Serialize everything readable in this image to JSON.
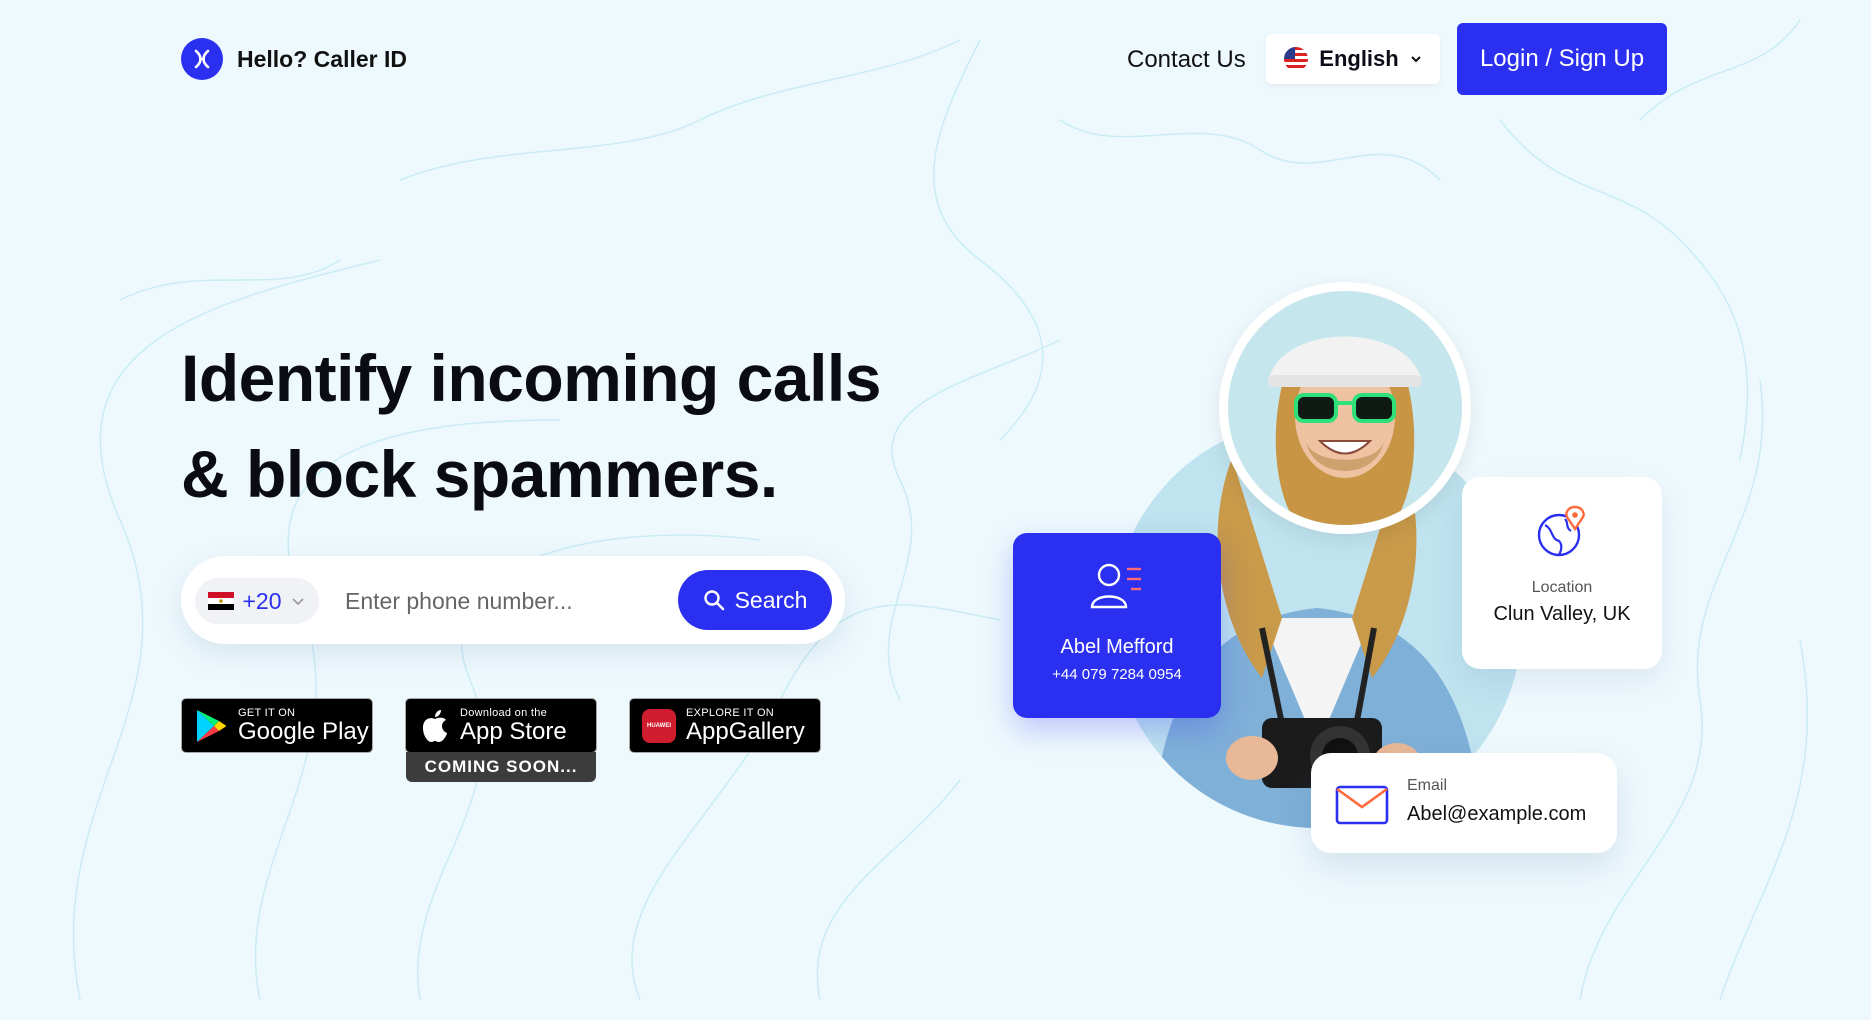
{
  "header": {
    "brand": "Hello? Caller ID",
    "contact_label": "Contact Us",
    "language": "English",
    "login_label": "Login / Sign Up"
  },
  "hero": {
    "headline_line1": "Identify incoming calls",
    "headline_line2": "& block spammers."
  },
  "search": {
    "country_code": "+20",
    "placeholder": "Enter phone number...",
    "button_label": "Search"
  },
  "stores": {
    "google": {
      "small": "GET IT ON",
      "big": "Google Play"
    },
    "apple": {
      "small": "Download on the",
      "big": "App Store",
      "badge": "COMING SOON..."
    },
    "huawei": {
      "small": "EXPLORE IT ON",
      "big": "AppGallery",
      "brand": "HUAWEI"
    }
  },
  "profile": {
    "name": "Abel Mefford",
    "phone": "+44 079 7284 0954",
    "location_label": "Location",
    "location_value": "Clun Valley, UK",
    "email_label": "Email",
    "email_value": "Abel@example.com"
  },
  "colors": {
    "accent": "#2a2ff0",
    "background": "#eef9fd",
    "location_pin": "#ff6a3d"
  },
  "icons": [
    "logo-icon",
    "us-flag-icon",
    "chevron-down-icon",
    "egypt-flag-icon",
    "search-icon",
    "google-play-icon",
    "apple-icon",
    "huawei-icon",
    "contact-card-icon",
    "globe-location-icon",
    "envelope-icon"
  ]
}
